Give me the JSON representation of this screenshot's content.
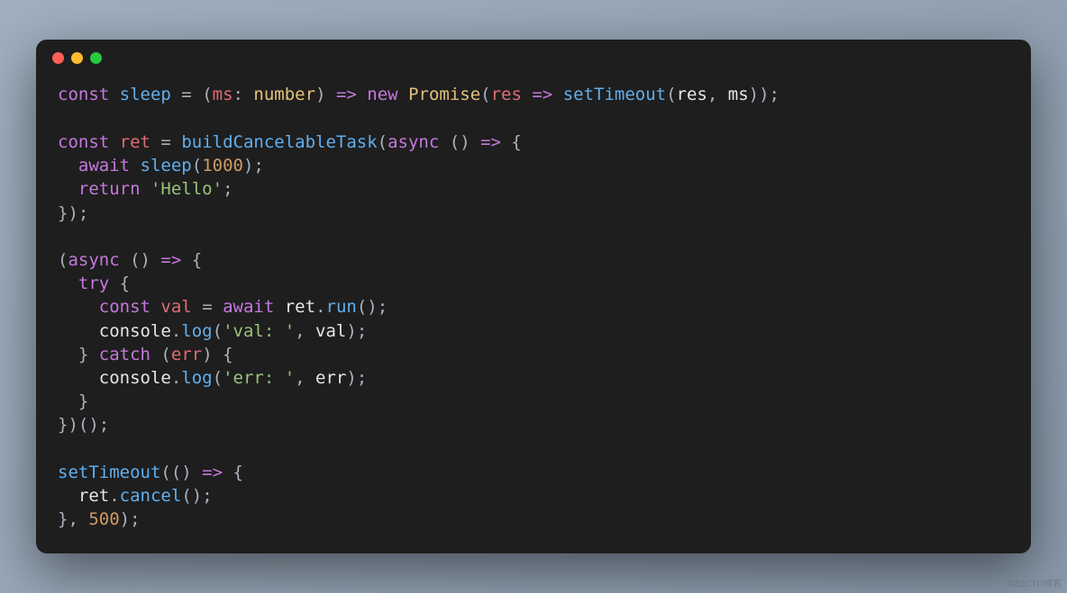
{
  "window": {
    "kind": "code-editor"
  },
  "traffic_lights": [
    "close",
    "minimize",
    "zoom"
  ],
  "code": {
    "l1": {
      "kw_const": "const",
      "v_sleep": "sleep",
      "eq": " = ",
      "lp": "(",
      "p_ms": "ms",
      "colon": ": ",
      "t_number": "number",
      "rp": ")",
      "arrow": " => ",
      "kw_new": "new",
      "sp": " ",
      "cls_promise": "Promise",
      "lp2": "(",
      "p_res": "res",
      "arrow2": " => ",
      "fn_setTimeout": "setTimeout",
      "lp3": "(",
      "a_res": "res",
      "comma": ", ",
      "a_ms": "ms",
      "rp3": ")",
      "rp2": ")",
      "semi": ";"
    },
    "l2": "",
    "l3": {
      "kw_const": "const",
      "v_ret": "ret",
      "eq": " = ",
      "fn_build": "buildCancelableTask",
      "lp": "(",
      "kw_async": "async",
      "unit": " () ",
      "arrow": "=>",
      "brace": " {"
    },
    "l4": {
      "indent": "  ",
      "kw_await": "await",
      "sp": " ",
      "fn_sleep": "sleep",
      "lp": "(",
      "n_1000": "1000",
      "rp_semi": ");"
    },
    "l5": {
      "indent": "  ",
      "kw_return": "return",
      "sp": " ",
      "str_hello": "'Hello'",
      "semi": ";"
    },
    "l6": {
      "txt": "});"
    },
    "l7": "",
    "l8": {
      "lp": "(",
      "kw_async": "async",
      "unit": " () ",
      "arrow": "=>",
      "brace": " {"
    },
    "l9": {
      "indent": "  ",
      "kw_try": "try",
      "brace": " {"
    },
    "l10": {
      "indent": "    ",
      "kw_const": "const",
      "v_val": "val",
      "eq": " = ",
      "kw_await": "await",
      "sp": " ",
      "o_ret": "ret",
      "dot": ".",
      "m_run": "run",
      "call": "();"
    },
    "l11": {
      "indent": "    ",
      "o_console": "console",
      "dot": ".",
      "m_log": "log",
      "lp": "(",
      "str_val": "'val: '",
      "comma": ", ",
      "a_val": "val",
      "rp_semi": ");"
    },
    "l12": {
      "indent": "  ",
      "brace_close": "} ",
      "kw_catch": "catch",
      "sp": " (",
      "p_err": "err",
      "rp_brace": ") {"
    },
    "l13": {
      "indent": "    ",
      "o_console": "console",
      "dot": ".",
      "m_log": "log",
      "lp": "(",
      "str_err": "'err: '",
      "comma": ", ",
      "a_err": "err",
      "rp_semi": ");"
    },
    "l14": {
      "indent": "  ",
      "txt": "}"
    },
    "l15": {
      "txt": "})();"
    },
    "l16": "",
    "l17": {
      "fn_setTimeout": "setTimeout",
      "lp": "(",
      "unit": "() ",
      "arrow": "=>",
      "brace": " {"
    },
    "l18": {
      "indent": "  ",
      "o_ret": "ret",
      "dot": ".",
      "m_cancel": "cancel",
      "call": "();"
    },
    "l19": {
      "brace": "}, ",
      "n_500": "500",
      "rp_semi": ");"
    }
  },
  "watermark": "©51CTO博客"
}
